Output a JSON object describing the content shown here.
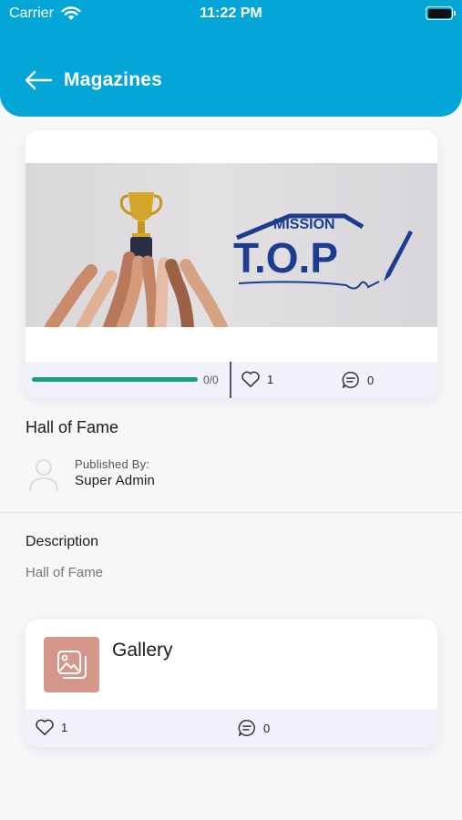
{
  "status_bar": {
    "carrier": "Carrier",
    "time": "11:22 PM"
  },
  "header": {
    "title": "Magazines"
  },
  "magazine": {
    "cover_brand_top": "MISSION",
    "cover_brand_main": "T.O.P",
    "progress_label": "0/0",
    "progress_fraction": 1.0,
    "likes": "1",
    "comments": "0",
    "title": "Hall of Fame",
    "published_by_label": "Published By:",
    "publisher": "Super Admin"
  },
  "description": {
    "heading": "Description",
    "text": "Hall of Fame"
  },
  "gallery": {
    "title": "Gallery",
    "likes": "1",
    "comments": "0"
  },
  "colors": {
    "header": "#03a6d6",
    "progress": "#159f84",
    "footer_bg": "#f1f0fb",
    "gallery_thumb": "#d4978a",
    "brand_navy": "#1b3c8f"
  },
  "icons": [
    "back-arrow-icon",
    "wifi-icon",
    "battery-icon",
    "heart-icon",
    "comment-icon",
    "user-icon",
    "image-icon"
  ]
}
